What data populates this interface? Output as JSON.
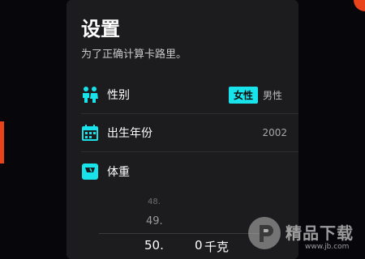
{
  "settings": {
    "title": "设置",
    "subtitle": "为了正确计算卡路里。",
    "gender": {
      "label": "性别",
      "options": [
        "女性",
        "男性"
      ],
      "selected": "女性"
    },
    "birth_year": {
      "label": "出生年份",
      "value": "2002"
    },
    "weight": {
      "label": "体重",
      "picker": {
        "above2": "48.",
        "above1": "49.",
        "selected": "50.",
        "decimal": "0",
        "unit": "千克"
      }
    }
  },
  "icons": {
    "gender": "people-icon",
    "birth_year": "calendar-icon",
    "weight": "scale-icon"
  },
  "watermark": {
    "text": "精品下载",
    "url": "www.jb.com"
  },
  "colors": {
    "accent": "#19e3ea",
    "panel": "#1c1c1e",
    "background": "#07070b",
    "side_accent": "#e8431b"
  }
}
